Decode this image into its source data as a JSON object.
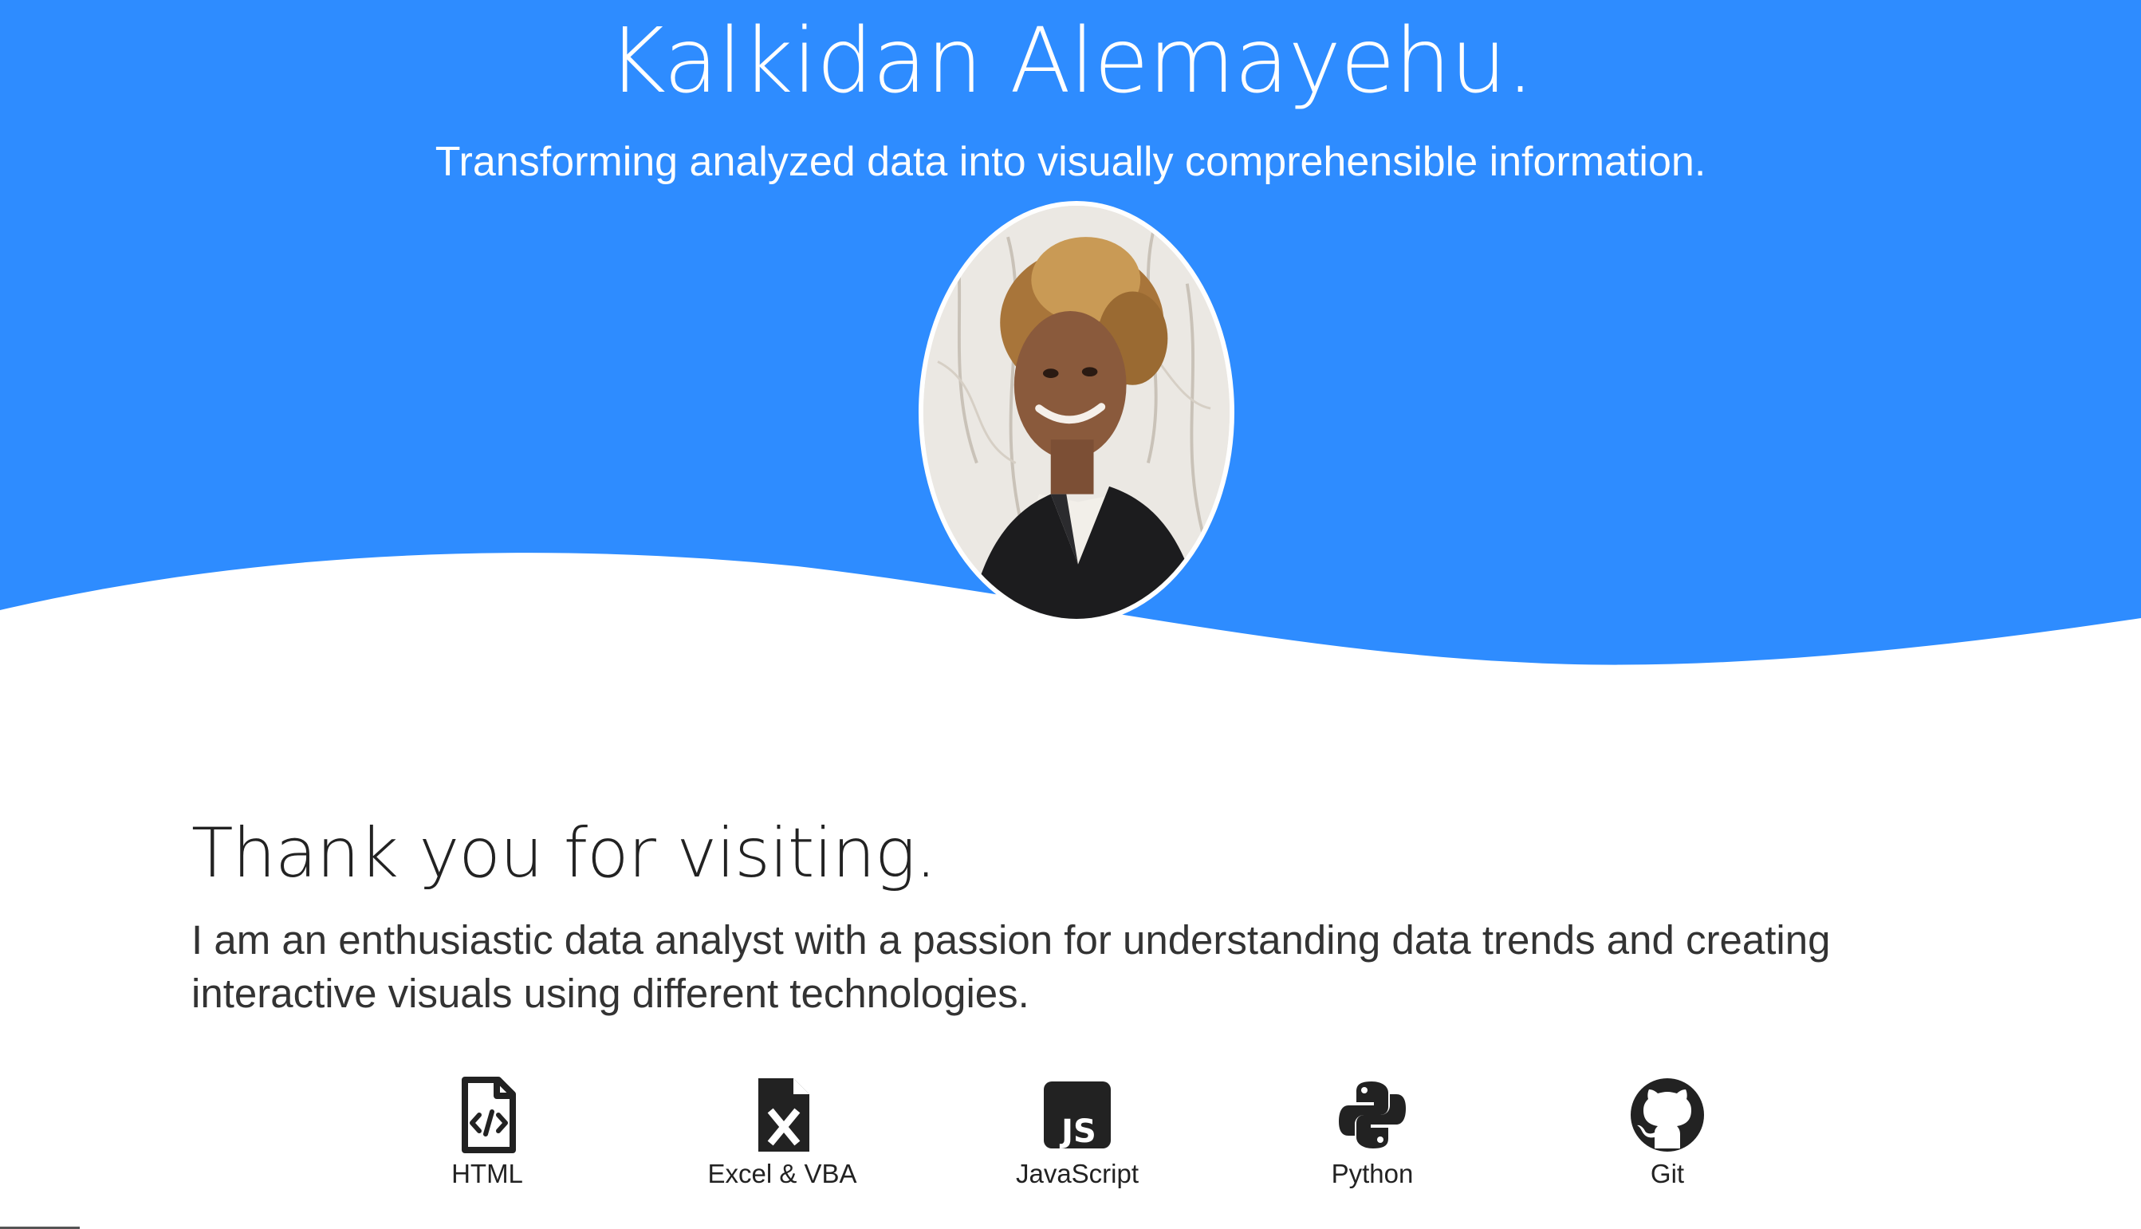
{
  "hero": {
    "title": "Kalkidan Alemayehu.",
    "subtitle": "Transforming analyzed data into visually comprehensible information."
  },
  "about": {
    "heading": "Thank you for visiting.",
    "text": "I am an enthusiastic data analyst with a passion for understanding data trends and creating interactive visuals using different technologies."
  },
  "skills": [
    {
      "label": "HTML",
      "icon": "html-file-icon"
    },
    {
      "label": "Excel & VBA",
      "icon": "excel-file-icon"
    },
    {
      "label": "JavaScript",
      "icon": "javascript-icon"
    },
    {
      "label": "Python",
      "icon": "python-icon"
    },
    {
      "label": "Git",
      "icon": "github-icon"
    }
  ],
  "colors": {
    "hero_blue": "#2e8cff",
    "text_dark": "#222222",
    "text_body": "#333333",
    "white": "#ffffff"
  }
}
